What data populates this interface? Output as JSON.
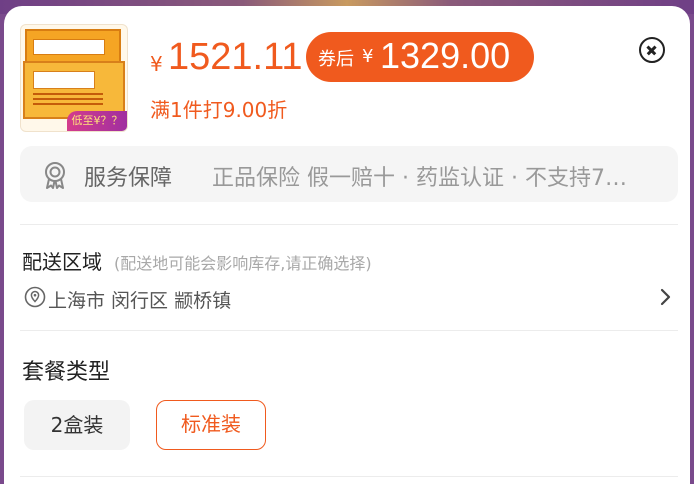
{
  "product": {
    "thumb_promo": "低至¥？？",
    "price_symbol": "¥",
    "price": "1521.11",
    "coupon_label": "券后",
    "coupon_symbol": "¥",
    "coupon_price": "1329.00",
    "discount_text": "满1件打9.00折"
  },
  "service": {
    "title": "服务保障",
    "detail": "正品保险 假一赔十 · 药监认证 · 不支持7…",
    "icon": "award-ribbon-icon"
  },
  "delivery": {
    "title": "配送区域",
    "note": "(配送地可能会影响库存,请正确选择)",
    "location": "上海市 闵行区 颛桥镇"
  },
  "package": {
    "title": "套餐类型",
    "options": [
      "2盒装",
      "标准装"
    ],
    "selected": "标准装"
  },
  "colors": {
    "accent": "#f05a1e",
    "muted_text": "#999999",
    "panel_bg": "#f5f5f5"
  }
}
